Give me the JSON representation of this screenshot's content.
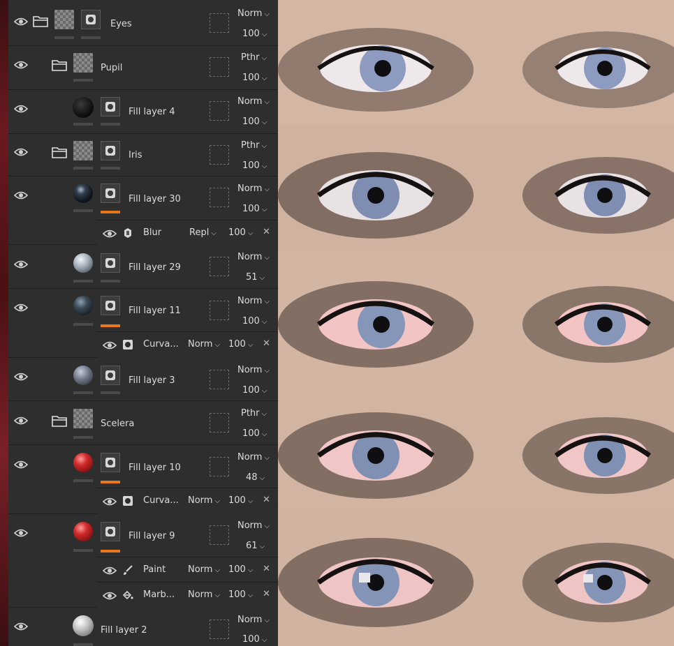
{
  "layers": [
    {
      "name": "Eyes",
      "blend": "Norm",
      "opacity": "100"
    },
    {
      "name": "Pupil",
      "blend": "Pthr",
      "opacity": "100"
    },
    {
      "name": "Fill layer 4",
      "blend": "Norm",
      "opacity": "100"
    },
    {
      "name": "Iris",
      "blend": "Pthr",
      "opacity": "100"
    },
    {
      "name": "Fill layer 30",
      "blend": "Norm",
      "opacity": "100"
    },
    {
      "name": "Fill layer 29",
      "blend": "Norm",
      "opacity": "51"
    },
    {
      "name": "Fill layer 11",
      "blend": "Norm",
      "opacity": "100"
    },
    {
      "name": "Fill layer 3",
      "blend": "Norm",
      "opacity": "100"
    },
    {
      "name": "Scelera",
      "blend": "Pthr",
      "opacity": "100"
    },
    {
      "name": "Fill layer 10",
      "blend": "Norm",
      "opacity": "48"
    },
    {
      "name": "Fill layer 9",
      "blend": "Norm",
      "opacity": "61"
    },
    {
      "name": "Fill layer 2",
      "blend": "Norm",
      "opacity": "100"
    }
  ],
  "effects": [
    {
      "name": "Blur",
      "blend": "Repl",
      "opacity": "100",
      "icon": "blur-filter-icon"
    },
    {
      "name": "Curva...",
      "blend": "Norm",
      "opacity": "100",
      "icon": "curvature-generator-icon"
    },
    {
      "name": "Curva...",
      "blend": "Norm",
      "opacity": "100",
      "icon": "curvature-generator-icon"
    },
    {
      "name": "Paint",
      "blend": "Norm",
      "opacity": "100",
      "icon": "brush-icon"
    },
    {
      "name": "Marb...",
      "blend": "Norm",
      "opacity": "100",
      "icon": "paint-bucket-icon"
    }
  ],
  "icons": {
    "eye": "eye-visibility-icon",
    "folder": "folder-icon",
    "close": "close-icon",
    "chevron": "chevron-down-icon"
  },
  "colors": {
    "panel": "#2e2e2e",
    "accent": "#e8761c",
    "text": "#dcdcdc"
  }
}
